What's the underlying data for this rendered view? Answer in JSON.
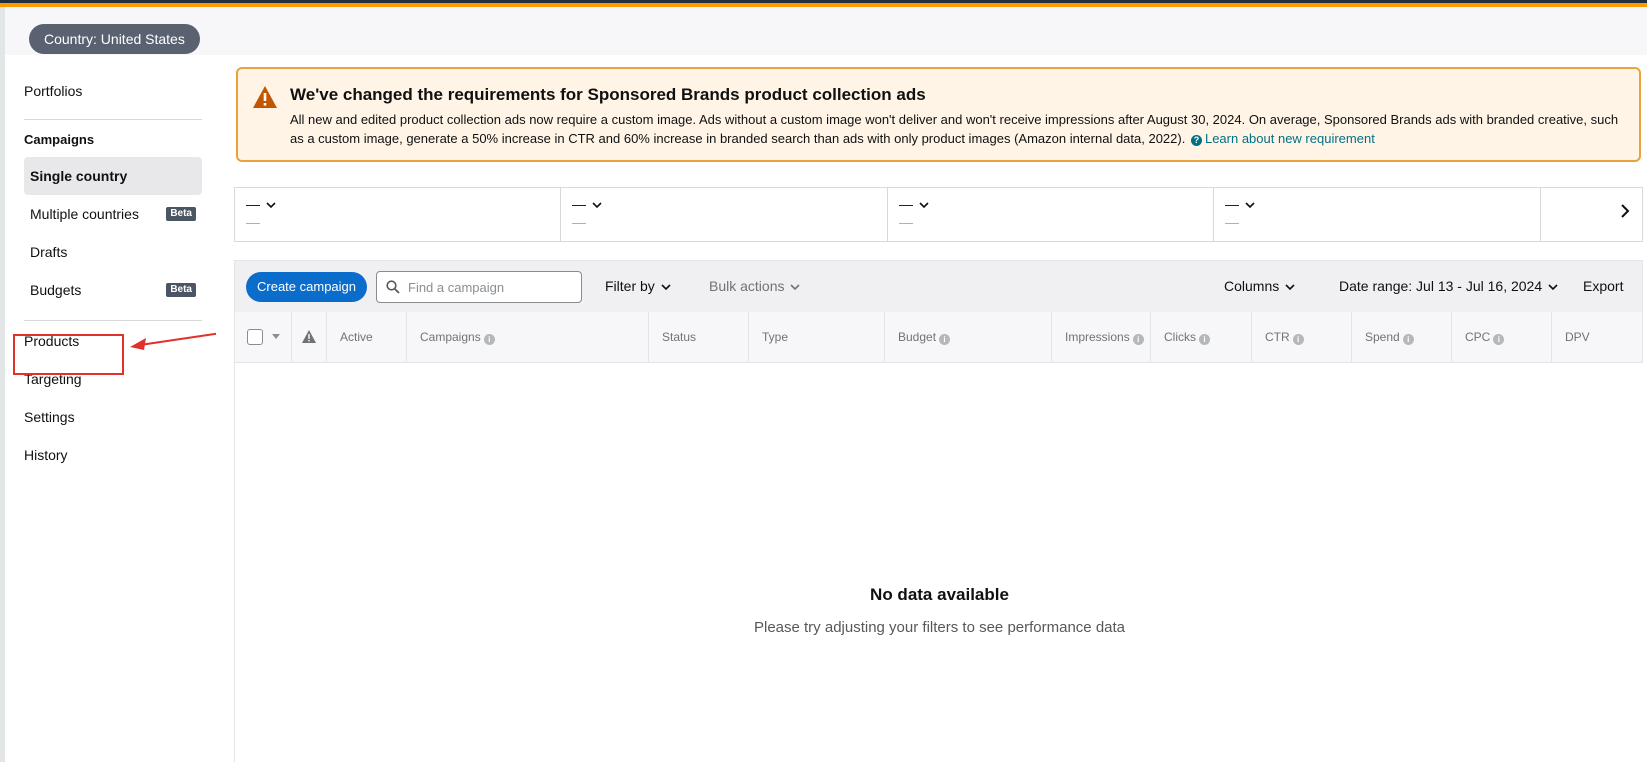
{
  "header": {
    "country_label": "Country: United States"
  },
  "sidebar": {
    "portfolios": "Portfolios",
    "campaigns_heading": "Campaigns",
    "items": [
      {
        "label": "Single country",
        "selected": true
      },
      {
        "label": "Multiple countries",
        "badge": "Beta"
      },
      {
        "label": "Drafts"
      },
      {
        "label": "Budgets",
        "badge": "Beta"
      }
    ],
    "products": "Products",
    "targeting": "Targeting",
    "settings": "Settings",
    "history": "History"
  },
  "alert": {
    "title": "We've changed the requirements for Sponsored Brands product collection ads",
    "body": "All new and edited product collection ads now require a custom image. Ads without a custom image won't deliver and won't receive impressions after August 30, 2024. On average, Sponsored Brands ads with branded creative, such as a custom image, generate a 50% increase in CTR and 60% increase in branded search than ads with only product images (Amazon internal data, 2022).",
    "link_label": "Learn about new requirement"
  },
  "metrics": [
    {
      "label": "—",
      "value": "—"
    },
    {
      "label": "—",
      "value": "—"
    },
    {
      "label": "—",
      "value": "—"
    },
    {
      "label": "—",
      "value": "—"
    }
  ],
  "toolbar": {
    "create_label": "Create campaign",
    "search_placeholder": "Find a campaign",
    "filter_label": "Filter by",
    "bulk_label": "Bulk actions",
    "columns_label": "Columns",
    "date_range_label": "Date range: Jul 13 - Jul 16, 2024",
    "export_label": "Export"
  },
  "table": {
    "columns": [
      "Active",
      "Campaigns",
      "Status",
      "Type",
      "Budget",
      "Impressions",
      "Clicks",
      "CTR",
      "Spend",
      "CPC",
      "DPV"
    ],
    "empty_title": "No data available",
    "empty_subtitle": "Please try adjusting your filters to see performance data"
  },
  "colors": {
    "accent": "#0a6dcc",
    "alert_border": "#e8a33d",
    "highlight": "#e0312b"
  }
}
